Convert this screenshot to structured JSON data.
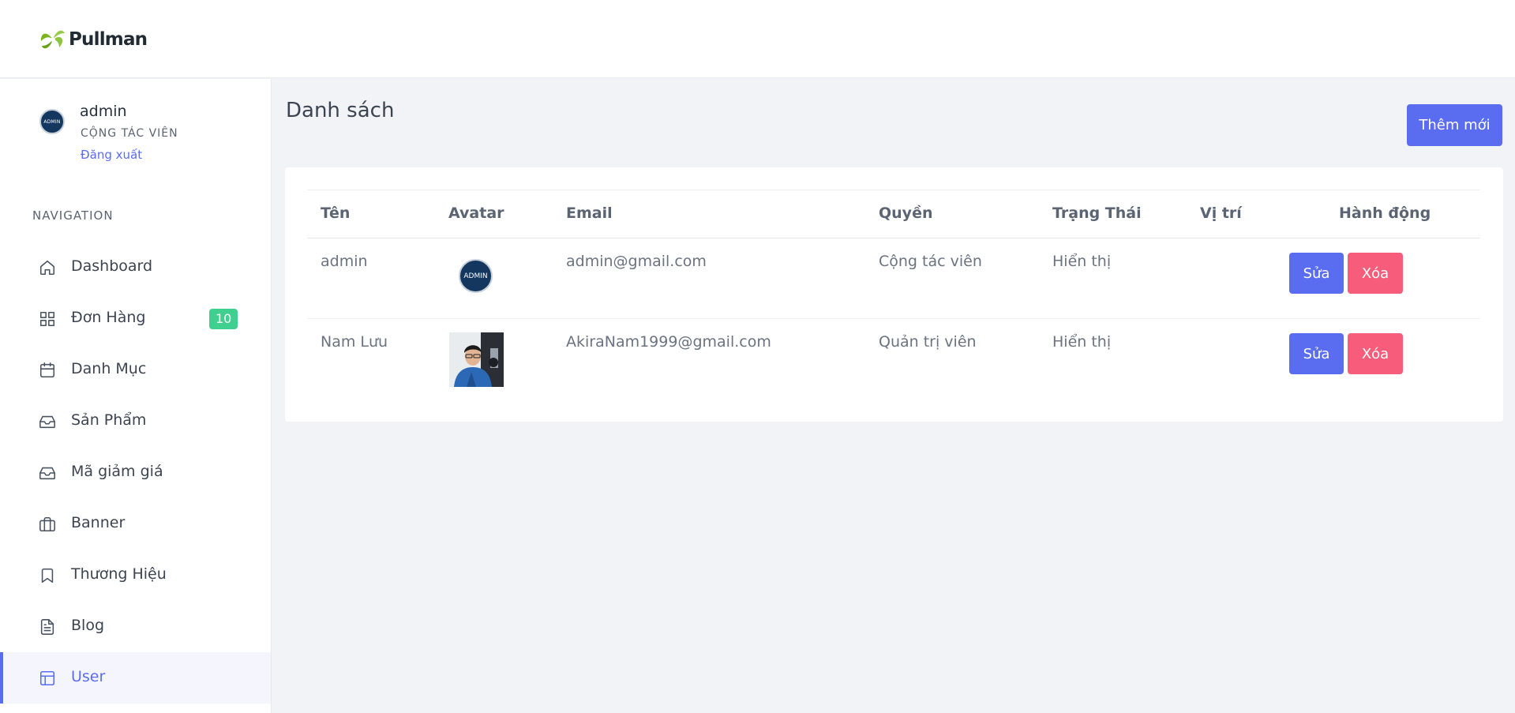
{
  "brand": {
    "name": "Pullman"
  },
  "user": {
    "name": "admin",
    "role": "CỘNG TÁC VIÊN",
    "logout": "Đăng xuất",
    "avatar_text": "ADMIN"
  },
  "nav": {
    "title": "NAVIGATION",
    "items": [
      {
        "label": "Dashboard",
        "icon": "home-icon"
      },
      {
        "label": "Đơn Hàng",
        "icon": "grid-icon",
        "badge": "10"
      },
      {
        "label": "Danh Mục",
        "icon": "calendar-icon"
      },
      {
        "label": "Sản Phẩm",
        "icon": "inbox-icon"
      },
      {
        "label": "Mã giảm giá",
        "icon": "inbox-icon"
      },
      {
        "label": "Banner",
        "icon": "briefcase-icon"
      },
      {
        "label": "Thương Hiệu",
        "icon": "bookmark-icon"
      },
      {
        "label": "Blog",
        "icon": "file-text-icon"
      },
      {
        "label": "User",
        "icon": "layout-icon",
        "active": true
      }
    ]
  },
  "page": {
    "title": "Danh sách",
    "add_button": "Thêm mới"
  },
  "table": {
    "headers": [
      "Tên",
      "Avatar",
      "Email",
      "Quyền",
      "Trạng Thái",
      "Vị trí",
      "Hành động"
    ],
    "rows": [
      {
        "name": "admin",
        "avatar": "ADMIN",
        "email": "admin@gmail.com",
        "role": "Cộng tác viên",
        "status": "Hiển thị",
        "position": "",
        "edit": "Sửa",
        "delete": "Xóa"
      },
      {
        "name": "Nam Lưu",
        "avatar": "",
        "email": "AkiraNam1999@gmail.com",
        "role": "Quản trị viên",
        "status": "Hiển thị",
        "position": "",
        "edit": "Sửa",
        "delete": "Xóa"
      }
    ]
  },
  "colors": {
    "primary": "#5a6cf0",
    "danger": "#f75d7a",
    "success": "#3fcf8e",
    "background": "#f1f3f7"
  }
}
